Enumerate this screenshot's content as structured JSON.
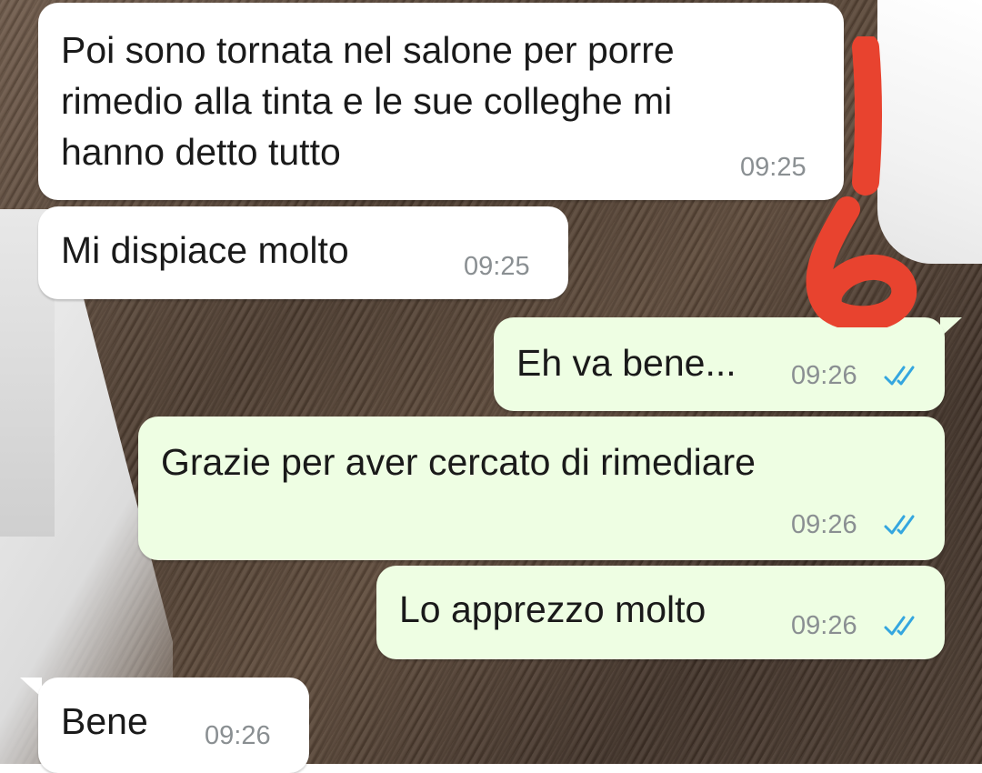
{
  "messages": [
    {
      "id": "m1",
      "direction": "incoming",
      "text": "Poi sono tornata nel salone per porre\nrimedio alla tinta e le sue colleghe mi\nhanno detto tutto",
      "time": "09:25"
    },
    {
      "id": "m2",
      "direction": "incoming",
      "text": "Mi dispiace molto",
      "time": "09:25"
    },
    {
      "id": "m3",
      "direction": "outgoing",
      "text": "Eh va bene...",
      "time": "09:26",
      "status": "read-double-check-icon"
    },
    {
      "id": "m4",
      "direction": "outgoing",
      "text": "Grazie per aver cercato di rimediare",
      "time": "09:26",
      "status": "read-double-check-icon"
    },
    {
      "id": "m5",
      "direction": "outgoing",
      "text": "Lo apprezzo molto",
      "time": "09:26",
      "status": "read-double-check-icon"
    },
    {
      "id": "m6",
      "direction": "incoming",
      "text": "Bene",
      "time": "09:26"
    }
  ],
  "annotation": {
    "label": "!6",
    "color": "#e8432f"
  },
  "colors": {
    "incoming_bubble": "#ffffff",
    "outgoing_bubble": "#eefee3",
    "read_ticks": "#34a6df",
    "timestamp": "#8a8f92"
  }
}
